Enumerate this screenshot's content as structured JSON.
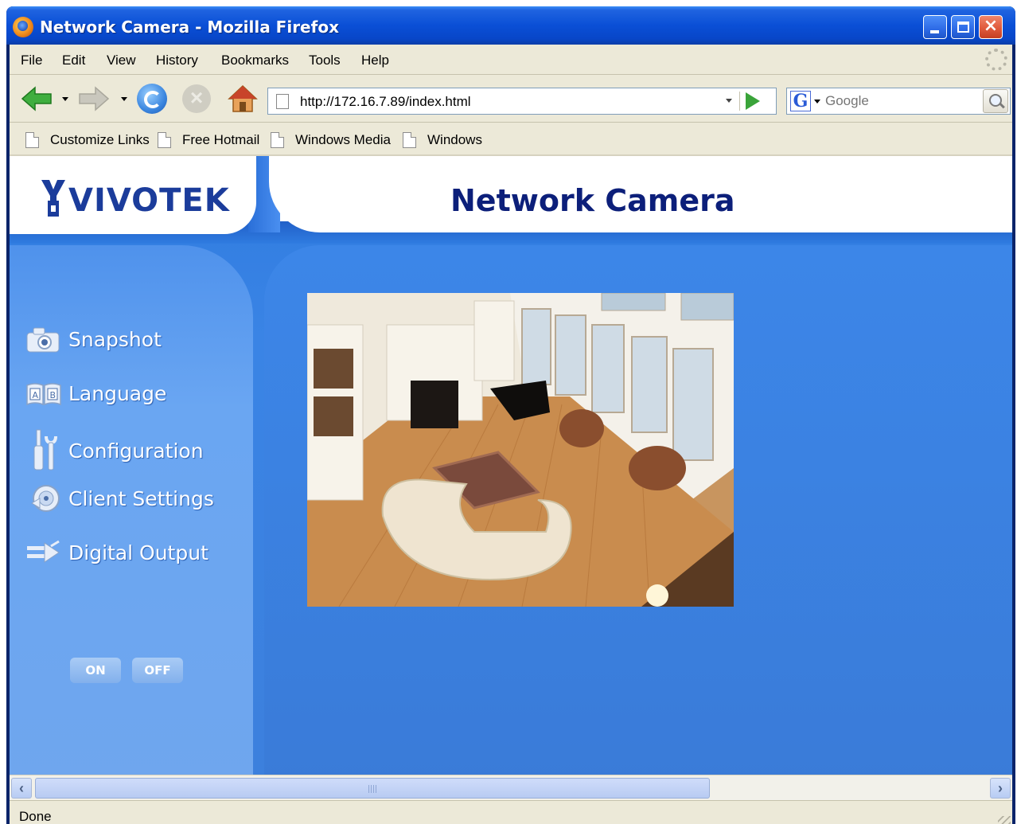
{
  "window": {
    "title": "Network Camera - Mozilla Firefox"
  },
  "menu": {
    "items": [
      "File",
      "Edit",
      "View",
      "History",
      "Bookmarks",
      "Tools",
      "Help"
    ]
  },
  "navigation": {
    "url": "http://172.16.7.89/index.html",
    "search_placeholder": "Google"
  },
  "bookmarks": [
    "Customize Links",
    "Free Hotmail",
    "Windows Media",
    "Windows"
  ],
  "page": {
    "logo_text": "VIVOTEK",
    "title": "Network Camera",
    "sidebar": [
      {
        "label": "Snapshot",
        "icon": "camera-icon"
      },
      {
        "label": "Language",
        "icon": "language-icon"
      },
      {
        "label": "Configuration",
        "icon": "tools-icon"
      },
      {
        "label": "Client Settings",
        "icon": "client-settings-icon"
      },
      {
        "label": "Digital Output",
        "icon": "digital-output-icon"
      }
    ],
    "digital_output": {
      "on_label": "ON",
      "off_label": "OFF"
    }
  },
  "status": {
    "text": "Done"
  },
  "colors": {
    "titlebar": "#0a4fd6",
    "chrome": "#ece9d8",
    "page_blue": "#3a84e5",
    "title_navy": "#0c1f7a"
  }
}
